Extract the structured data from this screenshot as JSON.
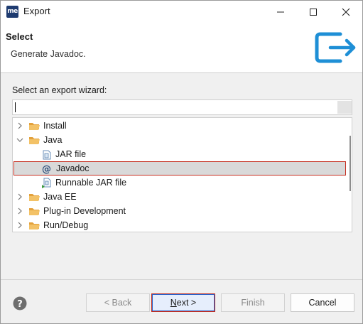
{
  "window": {
    "app_icon_text": "me",
    "title": "Export"
  },
  "header": {
    "title": "Select",
    "description": "Generate Javadoc."
  },
  "body": {
    "wizard_label": "Select an export wizard:",
    "filter_value": "",
    "tree": [
      {
        "label": "Install",
        "type": "folder",
        "expanded": false
      },
      {
        "label": "Java",
        "type": "folder",
        "expanded": true
      },
      {
        "label": "JAR file",
        "type": "jar-item"
      },
      {
        "label": "Javadoc",
        "type": "javadoc-item",
        "selected": true
      },
      {
        "label": "Runnable JAR file",
        "type": "runnable-jar-item"
      },
      {
        "label": "Java EE",
        "type": "folder",
        "expanded": false
      },
      {
        "label": "Plug-in Development",
        "type": "folder",
        "expanded": false
      },
      {
        "label": "Run/Debug",
        "type": "folder",
        "expanded": false
      }
    ]
  },
  "buttons": {
    "back": "< Back",
    "next": "Next >",
    "next_mnemonic": "N",
    "next_rest": "ext >",
    "finish": "Finish",
    "cancel": "Cancel"
  },
  "colors": {
    "accent": "#1e8fd6",
    "selection_border": "#c42b1c",
    "folder": "#e3a13b"
  }
}
